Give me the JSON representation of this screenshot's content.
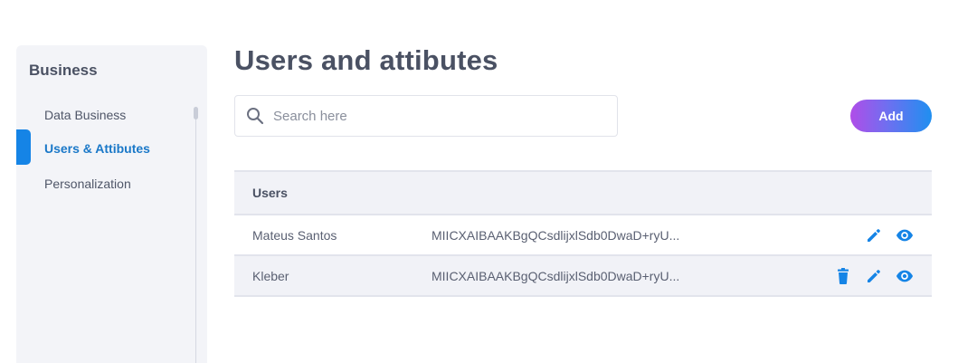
{
  "sidebar": {
    "title": "Business",
    "items": [
      {
        "label": "Data Business",
        "active": false
      },
      {
        "label": "Users & Attibutes",
        "active": true
      },
      {
        "label": "Personalization",
        "active": false
      }
    ]
  },
  "page": {
    "title": "Users and attibutes"
  },
  "search": {
    "placeholder": "Search here",
    "value": ""
  },
  "toolbar": {
    "add_label": "Add"
  },
  "table": {
    "header": "Users",
    "rows": [
      {
        "name": "Mateus Santos",
        "key": "MIICXAIBAAKBgQCsdlijxlSdb0DwaD+ryU...",
        "actions": [
          "edit-icon",
          "eye-icon"
        ]
      },
      {
        "name": "Kleber",
        "key": "MIICXAIBAAKBgQCsdlijxlSdb0DwaD+ryU...",
        "actions": [
          "trash-icon",
          "edit-icon",
          "eye-icon"
        ]
      }
    ]
  },
  "colors": {
    "accent": "#1584e6",
    "title": "#4a5163",
    "panel": "#f3f4f8",
    "button_gradient_start": "#b04de8",
    "button_gradient_end": "#1f8ff0"
  }
}
